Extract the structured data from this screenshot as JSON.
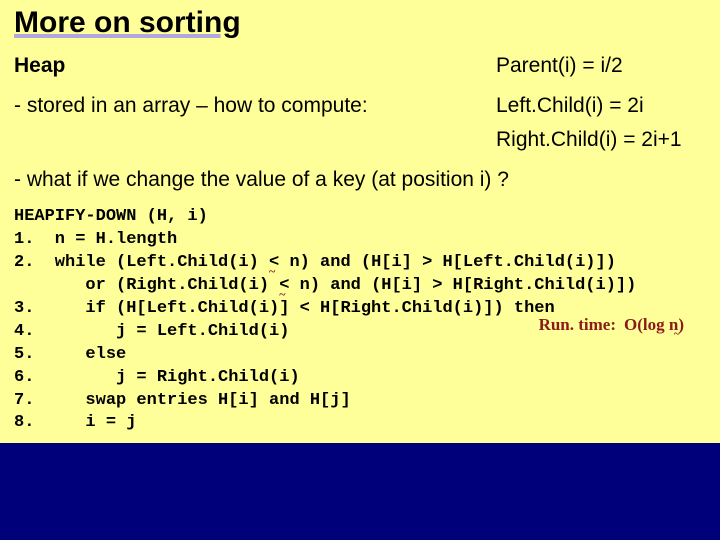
{
  "title": "More on sorting",
  "heap_label": "Heap",
  "stored_line": "- stored in an array – how to compute:",
  "parent_eq": "Parent(i) = i/2",
  "leftchild_eq": "Left.Child(i) = 2i",
  "rightchild_eq": "Right.Child(i) = 2i+1",
  "whatif_line": "- what if we change the value of a key (at position i) ?",
  "code": {
    "l0": "HEAPIFY-DOWN (H, i)",
    "l1": "1.  n = H.length",
    "l2a": "2.  while (Left.Child(i) ",
    "l2b": " n) and (H[i] > H[Left.Child(i)])",
    "l3a": "       or (Right.Child(i) ",
    "l3b": " n) and (H[i] > H[Right.Child(i)])",
    "l4": "3.     if (H[Left.Child(i)] < H[Right.Child(i)]) then",
    "l5": "4.        j = Left.Child(i)",
    "l6": "5.     else",
    "l7": "6.        j = Right.Child(i)",
    "l8": "7.     swap entries H[i] and H[j]",
    "l9": "8.     i = j"
  },
  "annot": {
    "leq": "<",
    "tilde": "~",
    "runtime_label": "Run. time:",
    "runtime_value": "O(log n)"
  }
}
